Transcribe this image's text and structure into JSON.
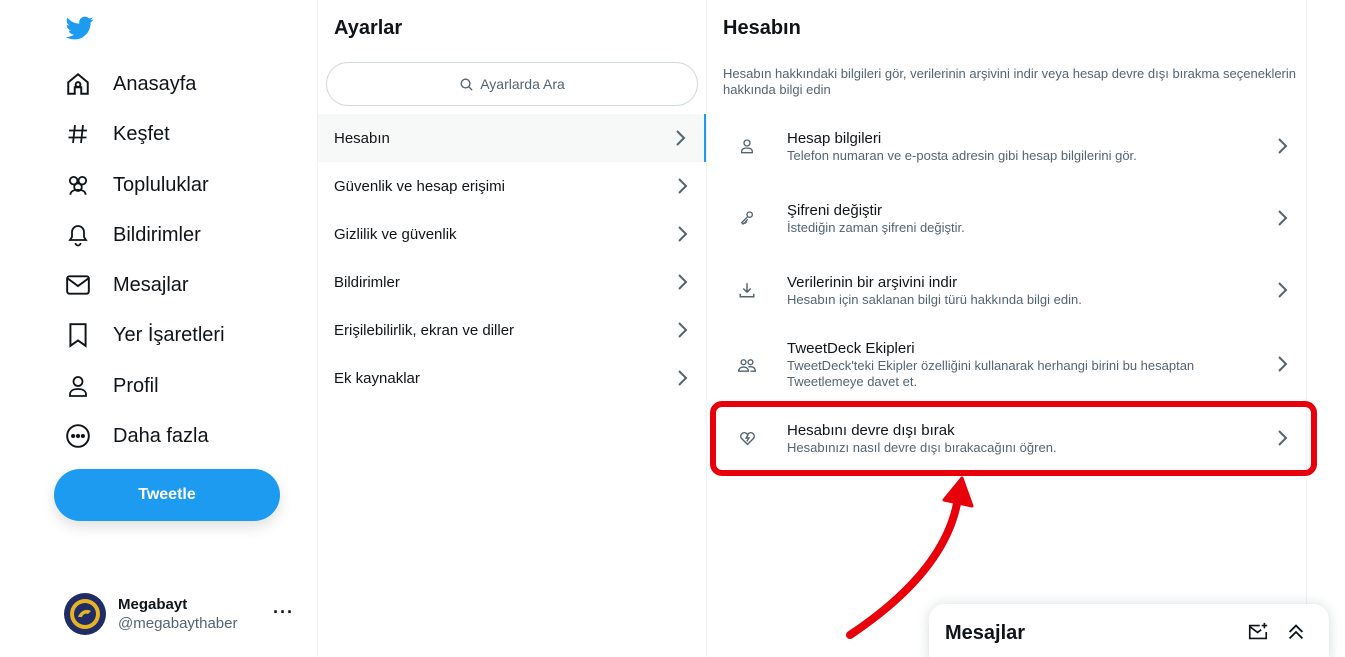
{
  "nav": {
    "items": [
      {
        "label": "Anasayfa",
        "icon": "home-icon"
      },
      {
        "label": "Keşfet",
        "icon": "hashtag-icon"
      },
      {
        "label": "Topluluklar",
        "icon": "communities-icon"
      },
      {
        "label": "Bildirimler",
        "icon": "bell-icon"
      },
      {
        "label": "Mesajlar",
        "icon": "envelope-icon"
      },
      {
        "label": "Yer İşaretleri",
        "icon": "bookmark-icon"
      },
      {
        "label": "Profil",
        "icon": "person-icon"
      },
      {
        "label": "Daha fazla",
        "icon": "more-circle-icon"
      }
    ],
    "tweet_label": "Tweetle"
  },
  "profile": {
    "name": "Megabayt",
    "handle": "@megabaythaber",
    "more": "···"
  },
  "settings": {
    "title": "Ayarlar",
    "search_placeholder": "Ayarlarda Ara",
    "items": [
      {
        "label": "Hesabın",
        "active": true
      },
      {
        "label": "Güvenlik ve hesap erişimi"
      },
      {
        "label": "Gizlilik ve güvenlik"
      },
      {
        "label": "Bildirimler"
      },
      {
        "label": "Erişilebilirlik, ekran ve diller"
      },
      {
        "label": "Ek kaynaklar"
      }
    ]
  },
  "account": {
    "title": "Hesabın",
    "description": "Hesabın hakkındaki bilgileri gör, verilerinin arşivini indir veya hesap devre dışı bırakma seçeneklerin hakkında bilgi edin",
    "items": [
      {
        "title": "Hesap bilgileri",
        "subtitle": "Telefon numaran ve e-posta adresin gibi hesap bilgilerini gör.",
        "icon": "person-icon"
      },
      {
        "title": "Şifreni değiştir",
        "subtitle": "İstediğin zaman şifreni değiştir.",
        "icon": "key-icon"
      },
      {
        "title": "Verilerinin bir arşivini indir",
        "subtitle": "Hesabın için saklanan bilgi türü hakkında bilgi edin.",
        "icon": "download-icon"
      },
      {
        "title": "TweetDeck Ekipleri",
        "subtitle": "TweetDeck'teki Ekipler özelliğini kullanarak herhangi birini bu hesaptan Tweetlemeye davet et.",
        "icon": "people-icon"
      },
      {
        "title": "Hesabını devre dışı bırak",
        "subtitle": "Hesabınızı nasıl devre dışı bırakacağını öğren.",
        "icon": "broken-heart-icon"
      }
    ]
  },
  "drawer": {
    "title": "Mesajlar"
  },
  "colors": {
    "accent": "#1d9bf0",
    "annotation": "#e8000b",
    "text": "#0f1419",
    "muted": "#536471"
  }
}
